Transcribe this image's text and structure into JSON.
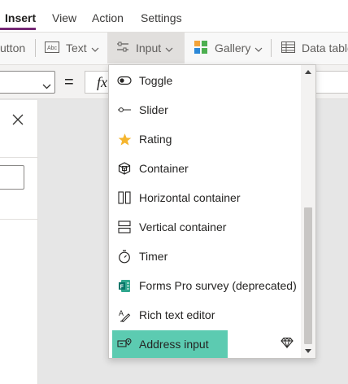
{
  "menubar": {
    "tabs": [
      {
        "label": "Insert",
        "active": true
      },
      {
        "label": "View"
      },
      {
        "label": "Action"
      },
      {
        "label": "Settings"
      }
    ]
  },
  "ribbon": {
    "button_label": "utton",
    "text_label": "Text",
    "input_label": "Input",
    "gallery_label": "Gallery",
    "datatable_label": "Data table"
  },
  "formulabar": {
    "equals": "=",
    "fx": "fx"
  },
  "dropdown": {
    "items": [
      {
        "label": "Toggle",
        "icon": "toggle-icon"
      },
      {
        "label": "Slider",
        "icon": "slider-icon"
      },
      {
        "label": "Rating",
        "icon": "star-icon"
      },
      {
        "label": "Container",
        "icon": "container-icon"
      },
      {
        "label": "Horizontal container",
        "icon": "horizontal-container-icon"
      },
      {
        "label": "Vertical container",
        "icon": "vertical-container-icon"
      },
      {
        "label": "Timer",
        "icon": "timer-icon"
      },
      {
        "label": "Forms Pro survey (deprecated)",
        "icon": "forms-pro-icon"
      },
      {
        "label": "Rich text editor",
        "icon": "rich-text-icon"
      },
      {
        "label": "Address input",
        "icon": "address-input-icon",
        "selected": true,
        "premium": true
      }
    ]
  },
  "colors": {
    "accent": "#742774",
    "selected_item": "#5ccbb1",
    "gallery_icon": [
      "#f2a33a",
      "#4caf50",
      "#2b88d8"
    ],
    "star": "#f5b52e",
    "forms_green": "#077568"
  }
}
